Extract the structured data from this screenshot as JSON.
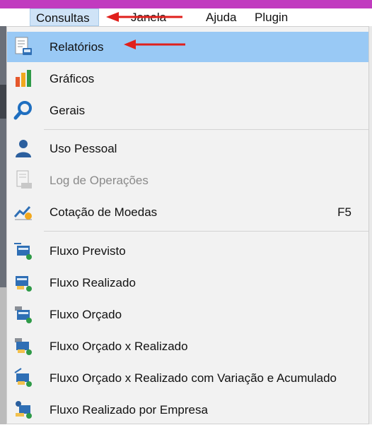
{
  "menubar": {
    "consultas": "Consultas",
    "janela": "Janela",
    "ajuda": "Ajuda",
    "plugin": "Plugin"
  },
  "menu": {
    "items": [
      {
        "label": "Relatórios",
        "icon": "report-icon"
      },
      {
        "label": "Gráficos",
        "icon": "bar-chart-icon"
      },
      {
        "label": "Gerais",
        "icon": "search-icon"
      },
      {
        "label": "Uso Pessoal",
        "icon": "user-icon"
      },
      {
        "label": "Log de Operações",
        "icon": "log-icon",
        "disabled": true
      },
      {
        "label": "Cotação de Moedas",
        "icon": "currency-chart-icon",
        "shortcut": "F5"
      },
      {
        "label": "Fluxo Previsto",
        "icon": "cashflow-forecast-icon"
      },
      {
        "label": "Fluxo Realizado",
        "icon": "cashflow-realized-icon"
      },
      {
        "label": "Fluxo Orçado",
        "icon": "cashflow-budget-icon"
      },
      {
        "label": "Fluxo Orçado x Realizado",
        "icon": "cashflow-budget-vs-realized-icon"
      },
      {
        "label": "Fluxo Orçado x Realizado com Variação e Acumulado",
        "icon": "cashflow-variation-icon"
      },
      {
        "label": "Fluxo Realizado por Empresa",
        "icon": "cashflow-company-icon"
      }
    ]
  },
  "colors": {
    "top_strip": "#c13bbf",
    "selection": "#99c9f5",
    "annotation_arrow": "#e0201c"
  }
}
